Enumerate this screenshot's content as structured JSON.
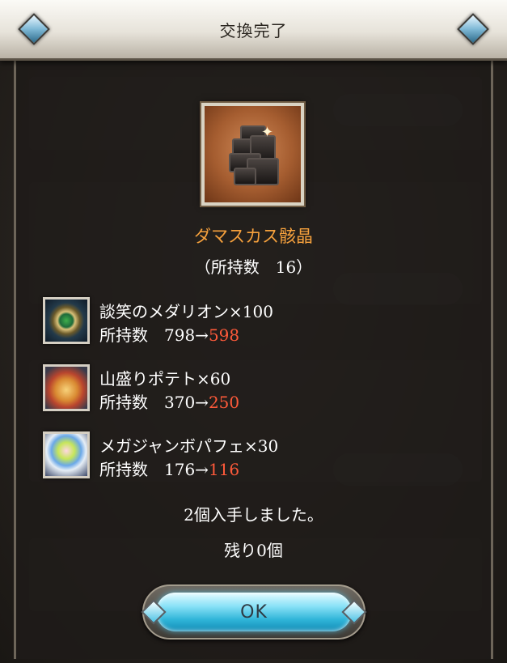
{
  "dialog": {
    "title": "交換完了",
    "item": {
      "name": "ダマスカス骸晶",
      "owned_text": "（所持数　16）",
      "image_icon": "damascus-crystal-icon"
    },
    "costs": [
      {
        "icon": "medallion-icon",
        "name": "談笑のメダリオン×100",
        "count_prefix": "所持数　798→",
        "count_after": "598"
      },
      {
        "icon": "potato-icon",
        "name": "山盛りポテト×60",
        "count_prefix": "所持数　370→",
        "count_after": "250"
      },
      {
        "icon": "parfait-icon",
        "name": "メガジャンボパフェ×30",
        "count_prefix": "所持数　176→",
        "count_after": "116"
      }
    ],
    "obtained_text": "2個入手しました。",
    "remaining_text": "残り0個",
    "ok_label": "OK"
  },
  "colors": {
    "item_name": "#f6a13d",
    "count_after": "#ff5a3a",
    "ok_button": "#2fb4d8"
  }
}
